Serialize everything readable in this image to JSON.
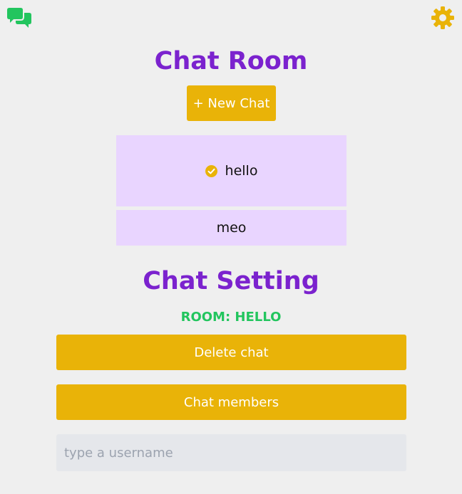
{
  "header": {
    "logo_icon": "chat-bubbles-icon",
    "settings_icon": "gear-icon"
  },
  "chat_room": {
    "title": "Chat Room",
    "new_chat_label": "+ New Chat",
    "rooms": [
      {
        "name": "hello",
        "selected": true,
        "status_icon": "check-circle-icon"
      },
      {
        "name": "meo",
        "selected": false
      }
    ]
  },
  "chat_setting": {
    "title": "Chat Setting",
    "room_label": "ROOM: HELLO",
    "delete_label": "Delete chat",
    "members_label": "Chat members",
    "username_placeholder": "type a username",
    "username_value": ""
  },
  "colors": {
    "accent_purple": "#7b22ce",
    "button_yellow": "#e9b308",
    "room_bg": "#e9d5ff",
    "room_label_green": "#22c55e",
    "logo_green": "#22c55e"
  }
}
